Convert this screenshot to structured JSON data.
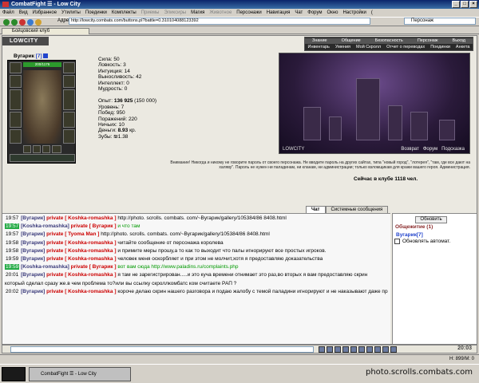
{
  "window": {
    "title": "CombatFight ☰ - Low City"
  },
  "menu": [
    {
      "label": "Файл",
      "disabled": false
    },
    {
      "label": "Вид",
      "disabled": false
    },
    {
      "label": "Избранное",
      "disabled": false
    },
    {
      "label": "Утилиты",
      "disabled": false
    },
    {
      "label": "Поединки",
      "disabled": false
    },
    {
      "label": "Комплекты",
      "disabled": false
    },
    {
      "label": "Приемы",
      "disabled": true
    },
    {
      "label": "Эликсиры",
      "disabled": true
    },
    {
      "label": "Магия",
      "disabled": false
    },
    {
      "label": "Животное",
      "disabled": true
    },
    {
      "label": "Персонажи",
      "disabled": false
    },
    {
      "label": "Навигация",
      "disabled": false
    },
    {
      "label": "Чат",
      "disabled": false
    },
    {
      "label": "Форум",
      "disabled": false
    },
    {
      "label": "Окно",
      "disabled": false
    },
    {
      "label": "Настройки",
      "disabled": false
    },
    {
      "label": "(",
      "disabled": false
    }
  ],
  "toolbar": {
    "address_label": "Адрес",
    "address": "http://lowcity.combats.com/buttons.pl?battle=0.310104088123392",
    "search_value": "Персонаж"
  },
  "tab": {
    "title": "Бойцовский клуб"
  },
  "game": {
    "logo": "LOWCITY",
    "nav_top": [
      "Знание",
      "Общение",
      "Безопасность",
      "Персонаж",
      "Выход"
    ],
    "nav_bottom": [
      "Инвентарь",
      "Умения",
      "Мой Скролл",
      "Отчет о переводах",
      "Поединки",
      "Анкета"
    ],
    "character": {
      "name": "Вугарик",
      "level": "[7]",
      "hp": "200/1176"
    },
    "stats": {
      "strength": "Сила: 50",
      "agility": "Ловкость: 3",
      "intuition": "Интуиция: 14",
      "endurance": "Выносливость: 42",
      "intellect": "Интеллект: 0",
      "wisdom": "Мудрость: 0",
      "exp_label": "Опыт:",
      "exp_value": "136 925",
      "exp_next": "(150 000)",
      "level": "Уровень: 7",
      "wins": "Побед: 950",
      "losses": "Поражений: 220",
      "draws": "Ничьих: 10",
      "money_label": "Деньги:",
      "money_value": "8.93",
      "money_unit": "кр.",
      "teeth": "Зубы: ₪1.38"
    },
    "scene": {
      "logo": "LOWCITY",
      "nav": [
        "Возврат",
        "Форум",
        "Подсказка"
      ]
    },
    "notice": "Внимание! Никогда и никому не говорите пароль от своего персонажа. Не вводите пароль на других сайтах, типа \"новый город\", \"лотерея\", \"там, где все дают на халяву\". Пароль не нужен ни паладинам, ни кланам, ни администрации; только взломщикам для кражи вашего героя. Администрация.",
    "online": "Сейчас в клубе 1118 чел."
  },
  "chat": {
    "tabs": [
      "Чат",
      "Системные сообщения"
    ],
    "messages": [
      {
        "time": "19:57",
        "green": false,
        "from": "[Вугарик]",
        "private": "private [ Koshka-romashka ]",
        "text": "http://photo. scrolls. combats. com/~Вугарик/gallery/105384/86 8408.html",
        "text_green": false
      },
      {
        "time": "19:57",
        "green": true,
        "from": "[Koshka-romashka]",
        "private": "private [ Вугарик ]",
        "text": "и что там",
        "text_green": true
      },
      {
        "time": "19:57",
        "green": false,
        "from": "[Вугарик]",
        "private": "private [ Tyoma Man ]",
        "text": "http://photo. scrolls. combats. com/~Вугарик/gallery/105384/86 8408.html",
        "text_green": false
      },
      {
        "time": "19:58",
        "green": false,
        "from": "[Вугарик]",
        "private": "private [ Koshka-romashka ]",
        "text": "читайте сообщение от персонажа королева",
        "text_green": false
      },
      {
        "time": "19:58",
        "green": false,
        "from": "[Вугарик]",
        "private": "private [ Koshka-romashka ]",
        "text": "и примите меры прошу,а то как то выходит что палы игнорируют все простых игроков.",
        "text_green": false
      },
      {
        "time": "19:59",
        "green": false,
        "from": "[Вугарик]",
        "private": "private [ Koshka-romashka ]",
        "text": "человек меня оскорбляет и при этом не молчит,хотя я предоставляю доказательства",
        "text_green": false
      },
      {
        "time": "19:59",
        "green": true,
        "from": "[Koshka-romashka]",
        "private": "private [ Вугарик ]",
        "text": "вот вам сюда http://www.paladins.ru/complaints.php",
        "text_green": true
      },
      {
        "time": "20:01",
        "green": false,
        "from": "[Вугарик]",
        "private": "private [ Koshka-romashka ]",
        "text": "я там не зарегистрирован.....и это куча времени отнимает это раз,во вторых я вам предоставляю скрин который сделал сразу же.в чем проблема то?или вы ссылку скроллкомбатс ком считаете РАП ?",
        "text_green": false
      },
      {
        "time": "20:02",
        "green": false,
        "from": "[Вугарик]",
        "private": "private [ Koshka-romashka ]",
        "text": "короче делаю скрин нашего разговора и подаю жалобу с темой паладини игнорируют и не наказывают даже при доказательстве",
        "text_green": false
      }
    ]
  },
  "sidebar": {
    "refresh": "Обновить",
    "title": "Общежитие (1)",
    "user": "Вугарик[7]",
    "auto_refresh": "Обновлять автомат."
  },
  "inputbar": {
    "clock": "20:03"
  },
  "statusbar": {
    "zoom": "Н: 899/М: 0"
  },
  "taskbar": {
    "window_button": "CombatFight ☰ - Low City"
  },
  "watermark": "photo.scrolls.combats.com",
  "colors": {
    "private": "#cc0000",
    "green": "#009900",
    "titlebar": "#0a246a"
  }
}
